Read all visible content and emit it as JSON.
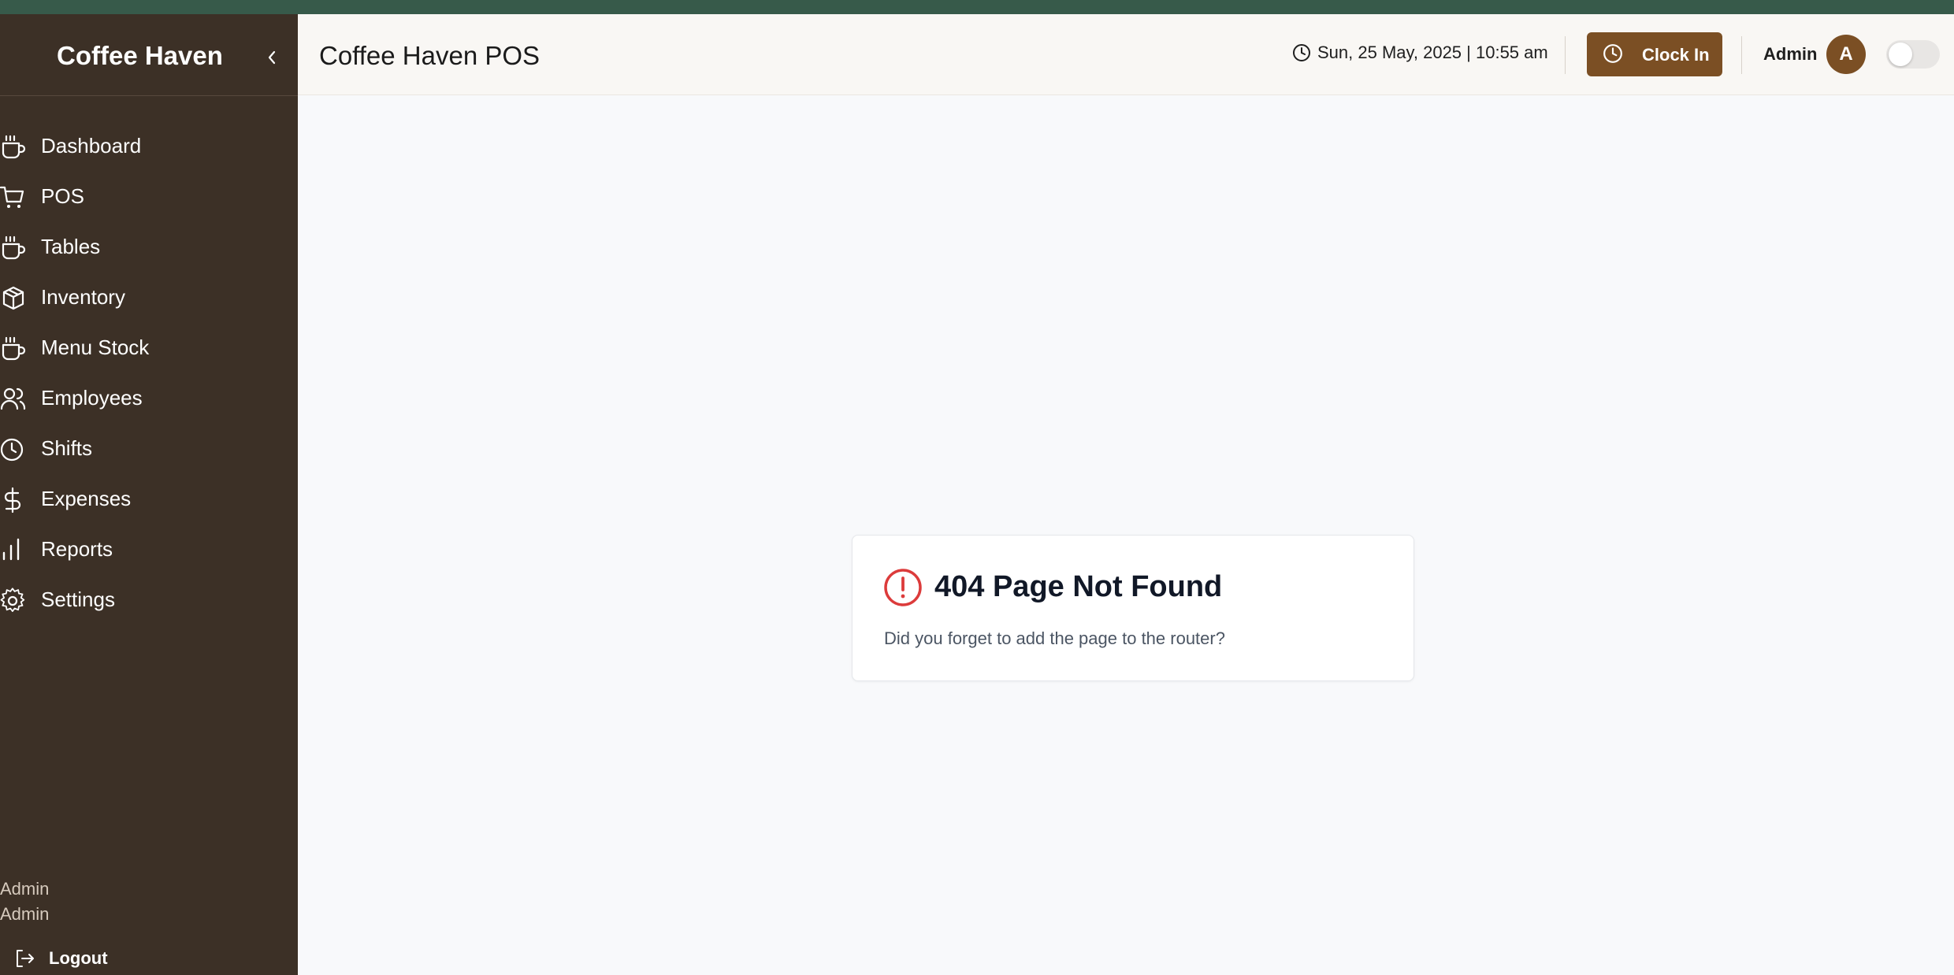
{
  "app": {
    "brand": "Coffee Haven",
    "colors": {
      "sidebar_bg": "#3c3026",
      "accent": "#7b4f24",
      "top_strip": "#375a4a",
      "error": "#dc3b3b"
    }
  },
  "sidebar": {
    "collapse_icon": "chevron-left-icon",
    "items": [
      {
        "label": "Dashboard",
        "icon": "coffee-cup-icon"
      },
      {
        "label": "POS",
        "icon": "cart-icon"
      },
      {
        "label": "Tables",
        "icon": "coffee-cup-icon"
      },
      {
        "label": "Inventory",
        "icon": "package-icon"
      },
      {
        "label": "Menu Stock",
        "icon": "coffee-cup-icon"
      },
      {
        "label": "Employees",
        "icon": "users-icon"
      },
      {
        "label": "Shifts",
        "icon": "clock-icon"
      },
      {
        "label": "Expenses",
        "icon": "dollar-icon"
      },
      {
        "label": "Reports",
        "icon": "bar-chart-icon"
      },
      {
        "label": "Settings",
        "icon": "gear-icon"
      }
    ],
    "user": {
      "name": "Admin",
      "role": "Admin"
    },
    "logout_label": "Logout"
  },
  "header": {
    "title": "Coffee Haven POS",
    "datetime": "Sun, 25 May, 2025 | 10:55 am",
    "clock_in_label": "Clock In",
    "admin_name": "Admin",
    "avatar_initial": "A",
    "theme_toggle_on": false
  },
  "main": {
    "error_title": "404 Page Not Found",
    "error_message": "Did you forget to add the page to the router?"
  }
}
